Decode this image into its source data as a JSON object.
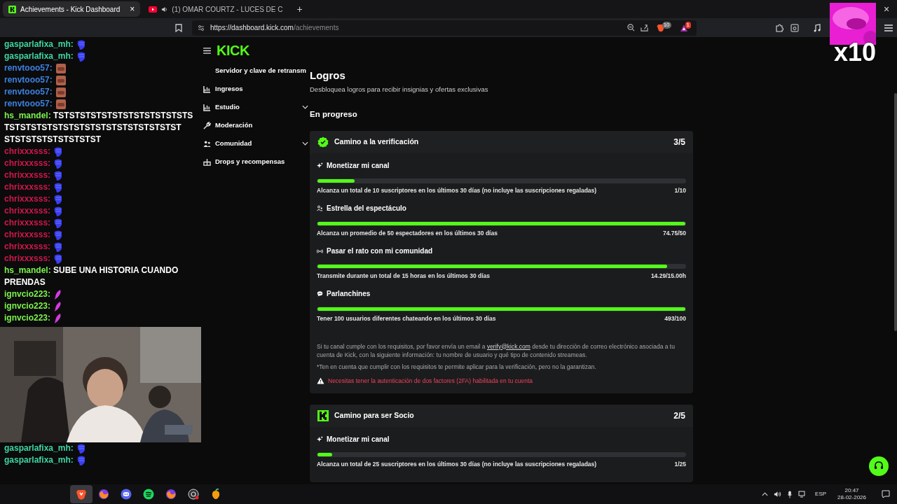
{
  "browser": {
    "tabs": [
      {
        "title": "Achievements - Kick Dashboard",
        "selected": true,
        "kind": "kick",
        "close": "×"
      },
      {
        "title": "(1) OMAR COURTZ - LUCES DE C",
        "selected": false,
        "kind": "youtube"
      }
    ],
    "new_tab": "+",
    "window_close": "×",
    "url_host": "https://dashboard.kick.com",
    "url_path": "/achievements",
    "badges": [
      {
        "kind": "brave",
        "count": "10"
      },
      {
        "kind": "rewards",
        "count": "1"
      }
    ]
  },
  "chat": [
    {
      "user": "gasparlafixa_mh:",
      "color": "#3fd6a0",
      "kind": "fist"
    },
    {
      "user": "gasparlafixa_mh:",
      "color": "#3fd6a0",
      "kind": "fist"
    },
    {
      "user": "renvtooo57:",
      "color": "#3b82e0",
      "kind": "face"
    },
    {
      "user": "renvtooo57:",
      "color": "#3b82e0",
      "kind": "face"
    },
    {
      "user": "renvtooo57:",
      "color": "#3b82e0",
      "kind": "face"
    },
    {
      "user": "renvtooo57:",
      "color": "#3b82e0",
      "kind": "face"
    },
    {
      "user": "hs_mandel:",
      "color": "#7cf24b",
      "message": "TSTSTSTSTSTSTSTSTSTSTSTSTS TSTSTSTSTSTSTSTSTSTSTSTSTSTSTSTST STSTSTSTSTSTSTSTST"
    },
    {
      "user": "chrixxxsss:",
      "color": "#d1184a",
      "kind": "fist"
    },
    {
      "user": "chrixxxsss:",
      "color": "#d1184a",
      "kind": "fist"
    },
    {
      "user": "chrixxxsss:",
      "color": "#d1184a",
      "kind": "fist"
    },
    {
      "user": "chrixxxsss:",
      "color": "#d1184a",
      "kind": "fist"
    },
    {
      "user": "chrixxxsss:",
      "color": "#d1184a",
      "kind": "fist"
    },
    {
      "user": "chrixxxsss:",
      "color": "#d1184a",
      "kind": "fist"
    },
    {
      "user": "chrixxxsss:",
      "color": "#d1184a",
      "kind": "fist"
    },
    {
      "user": "chrixxxsss:",
      "color": "#d1184a",
      "kind": "fist"
    },
    {
      "user": "chrixxxsss:",
      "color": "#d1184a",
      "kind": "fist"
    },
    {
      "user": "chrixxxsss:",
      "color": "#d1184a",
      "kind": "fist"
    },
    {
      "user": "hs_mandel:",
      "color": "#7cf24b",
      "message": "SUBE UNA HISTORIA CUANDO PRENDAS"
    },
    {
      "user": "ignvcio223:",
      "color": "#7cf24b",
      "kind": "feather"
    },
    {
      "user": "ignvcio223:",
      "color": "#7cf24b",
      "kind": "feather"
    },
    {
      "user": "ignvcio223:",
      "color": "#7cf24b",
      "kind": "feather"
    }
  ],
  "chat_bottom": [
    {
      "user": "gasparlafixa_mh:",
      "color": "#3fd6a0",
      "kind": "fist"
    },
    {
      "user": "gasparlafixa_mh:",
      "color": "#3fd6a0",
      "kind": "fist"
    }
  ],
  "sidebar": {
    "logo": "KICK",
    "items": [
      {
        "label": "Servidor y clave de retransm",
        "kind": "none",
        "expandable": false
      },
      {
        "label": "Ingresos",
        "kind": "chart",
        "expandable": false
      },
      {
        "label": "Estudio",
        "kind": "chart",
        "expandable": true
      },
      {
        "label": "Moderación",
        "kind": "wrench",
        "expandable": false
      },
      {
        "label": "Comunidad",
        "kind": "people",
        "expandable": true
      },
      {
        "label": "Drops y recompensas",
        "kind": "gift",
        "expandable": false
      }
    ]
  },
  "overlay": {
    "multiplier": "x10"
  },
  "page": {
    "title": "Logros",
    "subtitle": "Desbloquea logros para recibir insignias y ofertas exclusivas",
    "section": "En progreso",
    "cards": [
      {
        "kind": "verified",
        "title": "Camino a la verificación",
        "progress": "3/5",
        "items": [
          {
            "kind": "sparkle",
            "title": "Monetizar mi canal",
            "level": 0.1,
            "description": "Alcanza un total de 10 suscriptores en los últimos 30 días (no incluye las suscripciones regaladas)",
            "reading": "1/10"
          },
          {
            "kind": "people",
            "title": "Estrella del espectáculo",
            "level": 1,
            "description": "Alcanza un promedio de 50 espectadores en los últimos 30 días",
            "reading": "74.75/50"
          },
          {
            "kind": "broadcast",
            "title": "Pasar el rato con mi comunidad",
            "level": 0.95,
            "description": "Transmite durante un total de 15 horas en los últimos 30 días",
            "reading": "14.29/15.00h"
          },
          {
            "kind": "chat",
            "title": "Parlanchines",
            "level": 1,
            "description": "Tener 100 usuarios diferentes chateando en los últimos 30 días",
            "reading": "493/100"
          }
        ],
        "footer": {
          "text_before": "Si tu canal cumple con los requisitos, por favor envía un email a",
          "link": "verify@kick.com",
          "text_after": "desde tu dirección de correo electrónico asociada a tu cuenta de Kick, con la siguiente información: tu nombre de usuario y qué tipo de contenido streameas.",
          "note": "*Ten en cuenta que cumplir con los requisitos te permite aplicar para la verificación, pero no la garantizan.",
          "warning": "Necesitas tener la autenticación de dos factores (2FA) habilitada en tu cuenta"
        }
      },
      {
        "kind": "kick",
        "title": "Camino para ser Socio",
        "progress": "2/5",
        "items": [
          {
            "kind": "sparkle",
            "title": "Monetizar mi canal",
            "level": 0.04,
            "description": "Alcanza un total de 25 suscriptores en los últimos 30 días (no incluye las suscripciones regaladas)",
            "reading": "1/25"
          }
        ]
      }
    ]
  },
  "taskbar": {
    "language": "ESP",
    "time": "20:47",
    "date": "28-02-2026",
    "apps": [
      {
        "kind": "brave",
        "selected": true
      },
      {
        "kind": "firefox",
        "selected": false
      },
      {
        "kind": "discord",
        "selected": false
      },
      {
        "kind": "spotify",
        "selected": false
      },
      {
        "kind": "firefox",
        "selected": false
      },
      {
        "kind": "obs",
        "selected": false
      },
      {
        "kind": "fl",
        "selected": false
      }
    ]
  }
}
